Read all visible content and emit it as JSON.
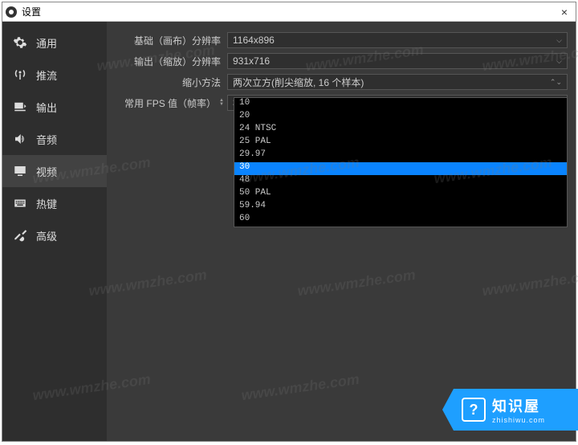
{
  "window": {
    "title": "设置",
    "close": "×"
  },
  "sidebar": {
    "items": [
      {
        "label": "通用"
      },
      {
        "label": "推流"
      },
      {
        "label": "输出"
      },
      {
        "label": "音频"
      },
      {
        "label": "视频"
      },
      {
        "label": "热键"
      },
      {
        "label": "高级"
      }
    ]
  },
  "form": {
    "base_res_label": "基础（画布）分辨率",
    "base_res_value": "1164x896",
    "output_res_label": "输出（缩放）分辨率",
    "output_res_value": "931x716",
    "downscale_label": "缩小方法",
    "downscale_value": "两次立方(削尖缩放, 16 个样本)",
    "fps_label": "常用 FPS 值（帧率）",
    "fps_value": "30"
  },
  "fps_options": [
    "10",
    "20",
    "24 NTSC",
    "25 PAL",
    "29.97",
    "30",
    "48",
    "50 PAL",
    "59.94",
    "60"
  ],
  "fps_selected": "30",
  "watermark": "www.wmzhe.com",
  "badge": {
    "title": "知识屋",
    "sub": "zhishiwu.com",
    "q": "?"
  }
}
